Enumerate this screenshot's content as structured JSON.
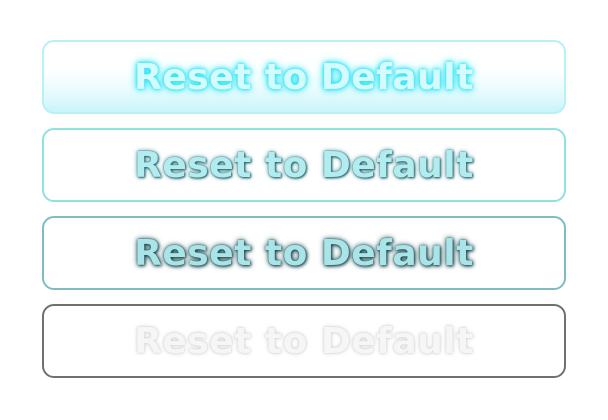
{
  "buttons": [
    {
      "state": "hover",
      "label": "Reset to Default"
    },
    {
      "state": "normal",
      "label": "Reset to Default"
    },
    {
      "state": "pressed",
      "label": "Reset to Default"
    },
    {
      "state": "disabled",
      "label": "Reset to Default"
    }
  ],
  "colors": {
    "hover_border": "#b9f0f4",
    "hover_glow": "#28e4f4",
    "normal_border": "#8ee3e0",
    "pressed_border": "#7fbcc0",
    "disabled_border": "#707070",
    "text_cyan": "#b2ecef"
  }
}
